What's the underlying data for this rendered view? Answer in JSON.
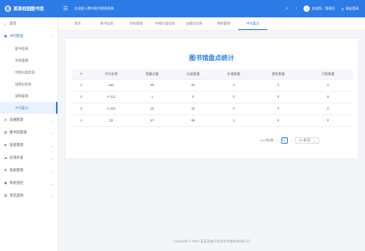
{
  "brand": {
    "logo_text": "图",
    "name": "某某校园图书馆"
  },
  "topbar": {
    "menu_icon": "☰",
    "welcome": "欢迎进入教学图书管理系统",
    "search_icon": "⌕",
    "bell_icon": "◔",
    "user_text": "欢迎您，管理员",
    "logout_icon": "⏻",
    "logout_text": "退出登录"
  },
  "sidebar": {
    "home": {
      "icon": "⌂",
      "label": "首页"
    },
    "books": {
      "icon": "▣",
      "label": "书刊管理",
      "chevron": "⌃"
    },
    "sub_items": [
      {
        "label": "图书信息"
      },
      {
        "label": "学科管理"
      },
      {
        "label": "中图分类信息"
      },
      {
        "label": "出版社信息"
      },
      {
        "label": "采购管理"
      },
      {
        "label": "书刊盘点",
        "active": true
      }
    ],
    "groups": [
      {
        "icon": "◎",
        "label": "流通管理",
        "chevron": "⌄"
      },
      {
        "icon": "▤",
        "label": "图书馆管理",
        "chevron": "⌄"
      },
      {
        "icon": "◈",
        "label": "读者管理",
        "chevron": "⌄"
      },
      {
        "icon": "☁",
        "label": "在线开发",
        "chevron": "⌄"
      },
      {
        "icon": "⚙",
        "label": "系统管理",
        "chevron": "⌄"
      },
      {
        "icon": "◉",
        "label": "系统监控",
        "chevron": "⌄"
      },
      {
        "icon": "▥",
        "label": "常见案例",
        "chevron": "⌄"
      }
    ]
  },
  "tabs": [
    {
      "label": "首页"
    },
    {
      "label": "图书信息"
    },
    {
      "label": "学科管理"
    },
    {
      "label": "中图分类信息"
    },
    {
      "label": "出版社信息"
    },
    {
      "label": "采购管理"
    },
    {
      "label": "书刊盘点",
      "active": true
    }
  ],
  "content": {
    "title": "图书馆盘点统计",
    "table": {
      "headers": [
        "#",
        "书刊名称",
        "馆藏总量",
        "在架数量",
        "外借数量",
        "遗失数量",
        "污损数量"
      ],
      "rows": [
        [
          "1",
          "aaa",
          "90",
          "84",
          "4",
          "2",
          "2"
        ],
        [
          "2",
          "A-111",
          "1",
          "0",
          "0",
          "0",
          "0"
        ],
        [
          "3",
          "A-222",
          "20",
          "20",
          "0",
          "0",
          "0"
        ],
        [
          "4",
          "22",
          "67",
          "65",
          "2",
          "0",
          "0"
        ]
      ]
    },
    "pager": {
      "summary": "1-4 共4条",
      "prev": "‹",
      "page": "1",
      "next": "›",
      "page_size": "10 条/页",
      "size_chevron": "⌄"
    }
  },
  "footer": {
    "text": "Copyright © 2022 某某某电子信息技术服务有限公司"
  }
}
